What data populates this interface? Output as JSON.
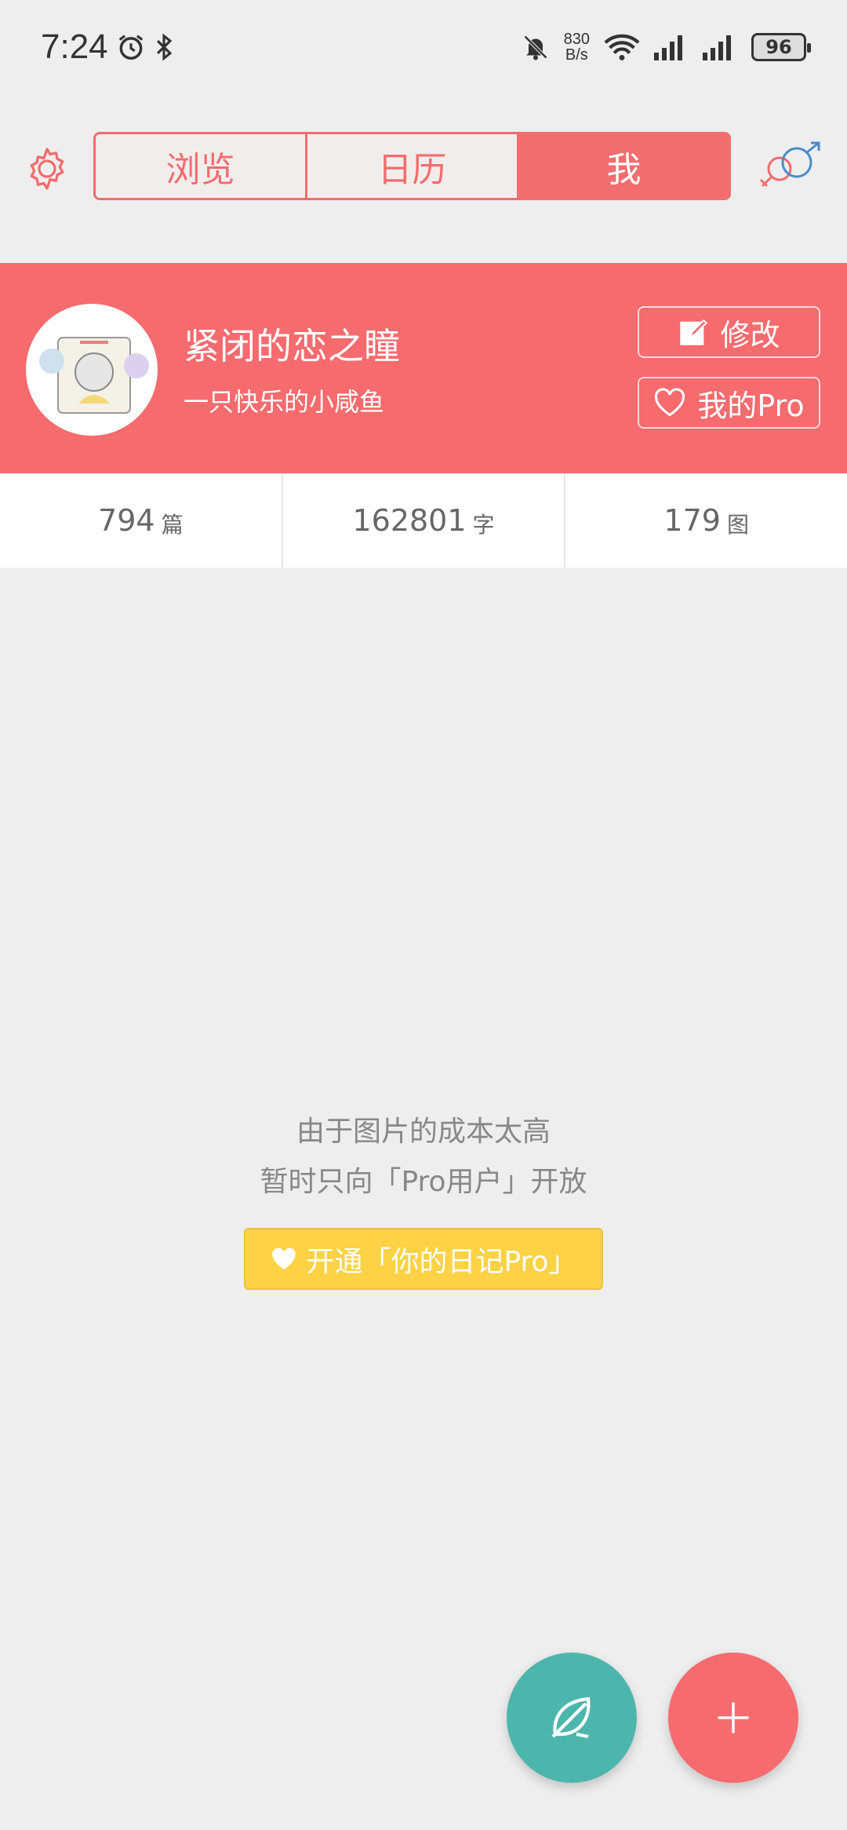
{
  "status_bar": {
    "time": "7:24",
    "net_speed_value": "830",
    "net_speed_unit": "B/s",
    "battery": "96"
  },
  "tabs": [
    {
      "label": "浏览",
      "active": false
    },
    {
      "label": "日历",
      "active": false
    },
    {
      "label": "我",
      "active": true
    }
  ],
  "profile": {
    "name": "紧闭的恋之瞳",
    "bio": "一只快乐的小咸鱼",
    "edit_label": "修改",
    "pro_label": "我的Pro"
  },
  "stats": [
    {
      "value": "794",
      "unit": "篇"
    },
    {
      "value": "162801",
      "unit": "字"
    },
    {
      "value": "179",
      "unit": "图"
    }
  ],
  "empty": {
    "line1": "由于图片的成本太高",
    "line2": "暂时只向「Pro用户」开放",
    "button_label": "开通「你的日记Pro」"
  },
  "icons": {
    "settings": "gear-icon",
    "gender": "gender-icon",
    "leaf": "leaf-icon",
    "add": "plus-icon"
  },
  "colors": {
    "accent": "#f56b6e",
    "teal": "#4db6ac",
    "yellow": "#fdd245"
  }
}
